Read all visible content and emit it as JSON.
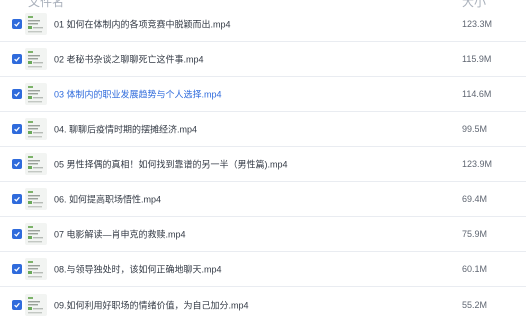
{
  "header": {
    "name_label": "文件名",
    "size_label": "大小"
  },
  "files": [
    {
      "name": "01 如何在体制内的各项竞赛中脱颖而出.mp4",
      "size": "123.3M",
      "checked": true,
      "active": false
    },
    {
      "name": "02 老秘书杂谈之聊聊死亡这件事.mp4",
      "size": "115.9M",
      "checked": true,
      "active": false
    },
    {
      "name": "03 体制内的职业发展趋势与个人选择.mp4",
      "size": "114.6M",
      "checked": true,
      "active": true
    },
    {
      "name": "04. 聊聊后疫情时期的摆摊经济.mp4",
      "size": "99.5M",
      "checked": true,
      "active": false
    },
    {
      "name": "05 男性择偶的真相！如何找到靠谱的另一半（男性篇).mp4",
      "size": "123.9M",
      "checked": true,
      "active": false
    },
    {
      "name": "06. 如何提高职场悟性.mp4",
      "size": "69.4M",
      "checked": true,
      "active": false
    },
    {
      "name": "07 电影解读—肖申克的救赎.mp4",
      "size": "75.9M",
      "checked": true,
      "active": false
    },
    {
      "name": "08.与领导独处时，该如何正确地聊天.mp4",
      "size": "60.1M",
      "checked": true,
      "active": false
    },
    {
      "name": "09.如何利用好职场的情绪价值，为自己加分.mp4",
      "size": "55.2M",
      "checked": true,
      "active": false
    }
  ],
  "icons": {
    "checkbox": "checkmark-icon",
    "thumbnail": "video-file-icon"
  },
  "colors": {
    "accent": "#2f6bdc",
    "text": "#333a45",
    "size_text": "#5f6672",
    "divider": "#e9ecf1"
  }
}
